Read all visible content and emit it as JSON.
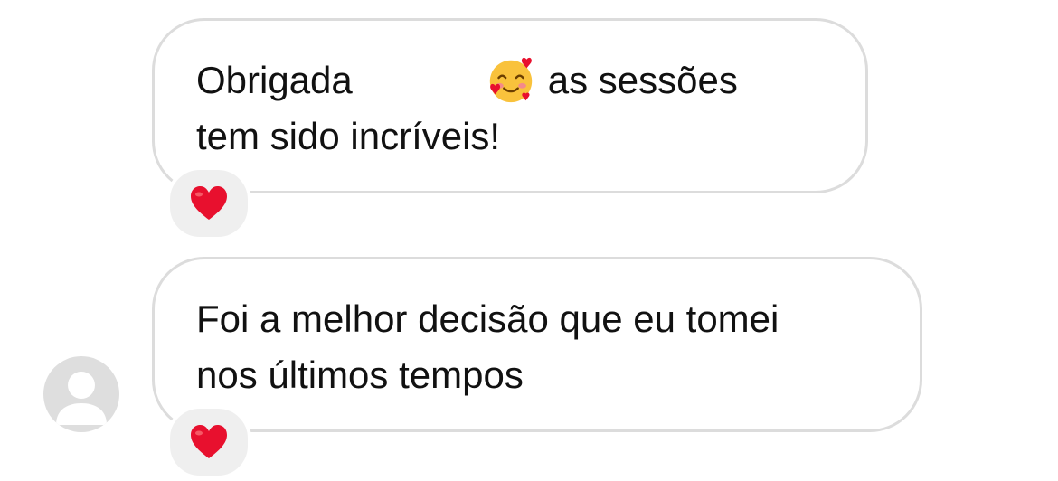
{
  "messages": [
    {
      "line1_before": "Obrigada",
      "line1_after": "as sessões",
      "line2": "tem sido incríveis!",
      "inline_emoji": "smiling-face-with-hearts",
      "reaction": "red-heart"
    },
    {
      "line1": "Foi a melhor decisão que eu tomei",
      "line2": "nos últimos tempos",
      "reaction": "red-heart"
    }
  ],
  "colors": {
    "bubble_border": "#dcdcdc",
    "reaction_bg": "#efefef",
    "heart": "#e8102e",
    "avatar_bg": "#dedede",
    "text": "#111111"
  }
}
